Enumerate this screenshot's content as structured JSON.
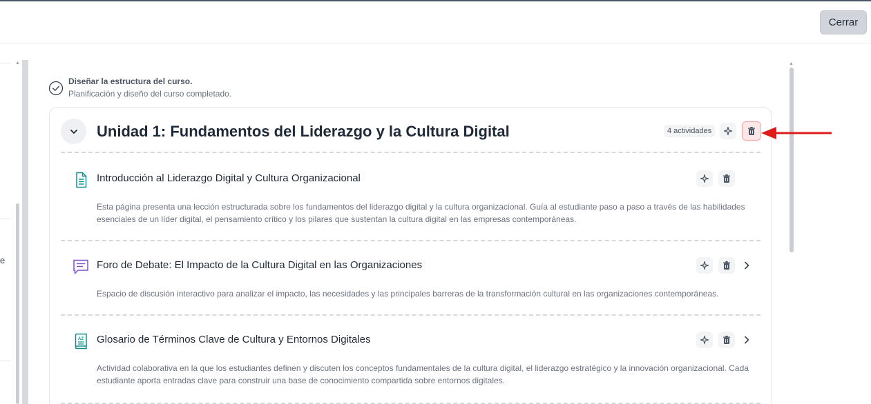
{
  "header": {
    "close_label": "Cerrar"
  },
  "sidebar": {
    "partial_text": "e"
  },
  "status": {
    "title": "Diseñar la estructura del curso.",
    "subtitle": "Planificación y diseño del curso completado."
  },
  "unit": {
    "title": "Unidad 1: Fundamentos del Liderazgo y la Cultura Digital",
    "activities_badge": "4 actividades"
  },
  "activities": [
    {
      "icon": "document-icon",
      "title": "Introducción al Liderazgo Digital y Cultura Organizacional",
      "description": "Esta página presenta una lección estructurada sobre los fundamentos del liderazgo digital y la cultura organizacional. Guía al estudiante paso a paso a través de las habilidades esenciales de un líder digital, el pensamiento crítico y los pilares que sustentan la cultura digital en las empresas contemporáneas."
    },
    {
      "icon": "forum-icon",
      "title": "Foro de Debate: El Impacto de la Cultura Digital en las Organizaciones",
      "description": "Espacio de discusión interactivo para analizar el impacto, las necesidades y las principales barreras de la transformación cultural en las organizaciones contemporáneas."
    },
    {
      "icon": "glossary-icon",
      "title": "Glosario de Términos Clave de Cultura y Entornos Digitales",
      "description": "Actividad colaborativa en la que los estudiantes definen y discuten los conceptos fundamentales de la cultura digital, el liderazgo estratégico y la innovación organizacional. Cada estudiante aporta entradas clave para construir una base de conocimiento compartida sobre entornos digitales."
    }
  ],
  "colors": {
    "accent_teal": "#0e8f8a",
    "forum_purple": "#7c4dcc",
    "annotation_red": "#e01b1b"
  }
}
